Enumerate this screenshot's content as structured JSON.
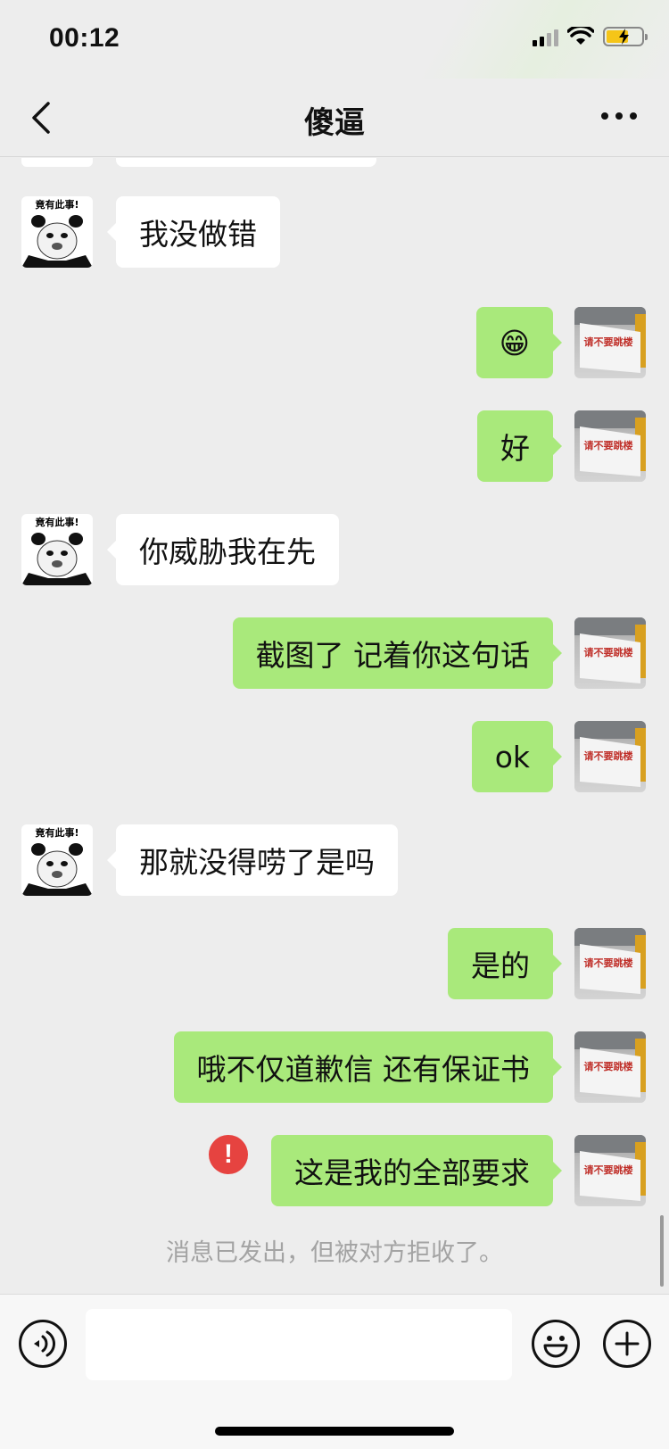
{
  "status_bar": {
    "time": "00:12"
  },
  "nav": {
    "title": "傻逼"
  },
  "messages": [
    {
      "side": "left",
      "text": "我没做错"
    },
    {
      "side": "right",
      "text": "😁"
    },
    {
      "side": "right",
      "text": "好"
    },
    {
      "side": "left",
      "text": "你威胁我在先"
    },
    {
      "side": "right",
      "text": "截图了 记着你这句话"
    },
    {
      "side": "right",
      "text": "ok"
    },
    {
      "side": "left",
      "text": "那就没得唠了是吗"
    },
    {
      "side": "right",
      "text": "是的"
    },
    {
      "side": "right",
      "text": "哦不仅道歉信 还有保证书"
    },
    {
      "side": "right",
      "text": "这是我的全部要求",
      "failed": true
    }
  ],
  "avatars": {
    "contact_caption": "竟有此事!",
    "self_sign_text": "请不要跳楼"
  },
  "error_mark": "!",
  "system_note": "消息已发出，但被对方拒收了。",
  "input": {
    "value": ""
  }
}
